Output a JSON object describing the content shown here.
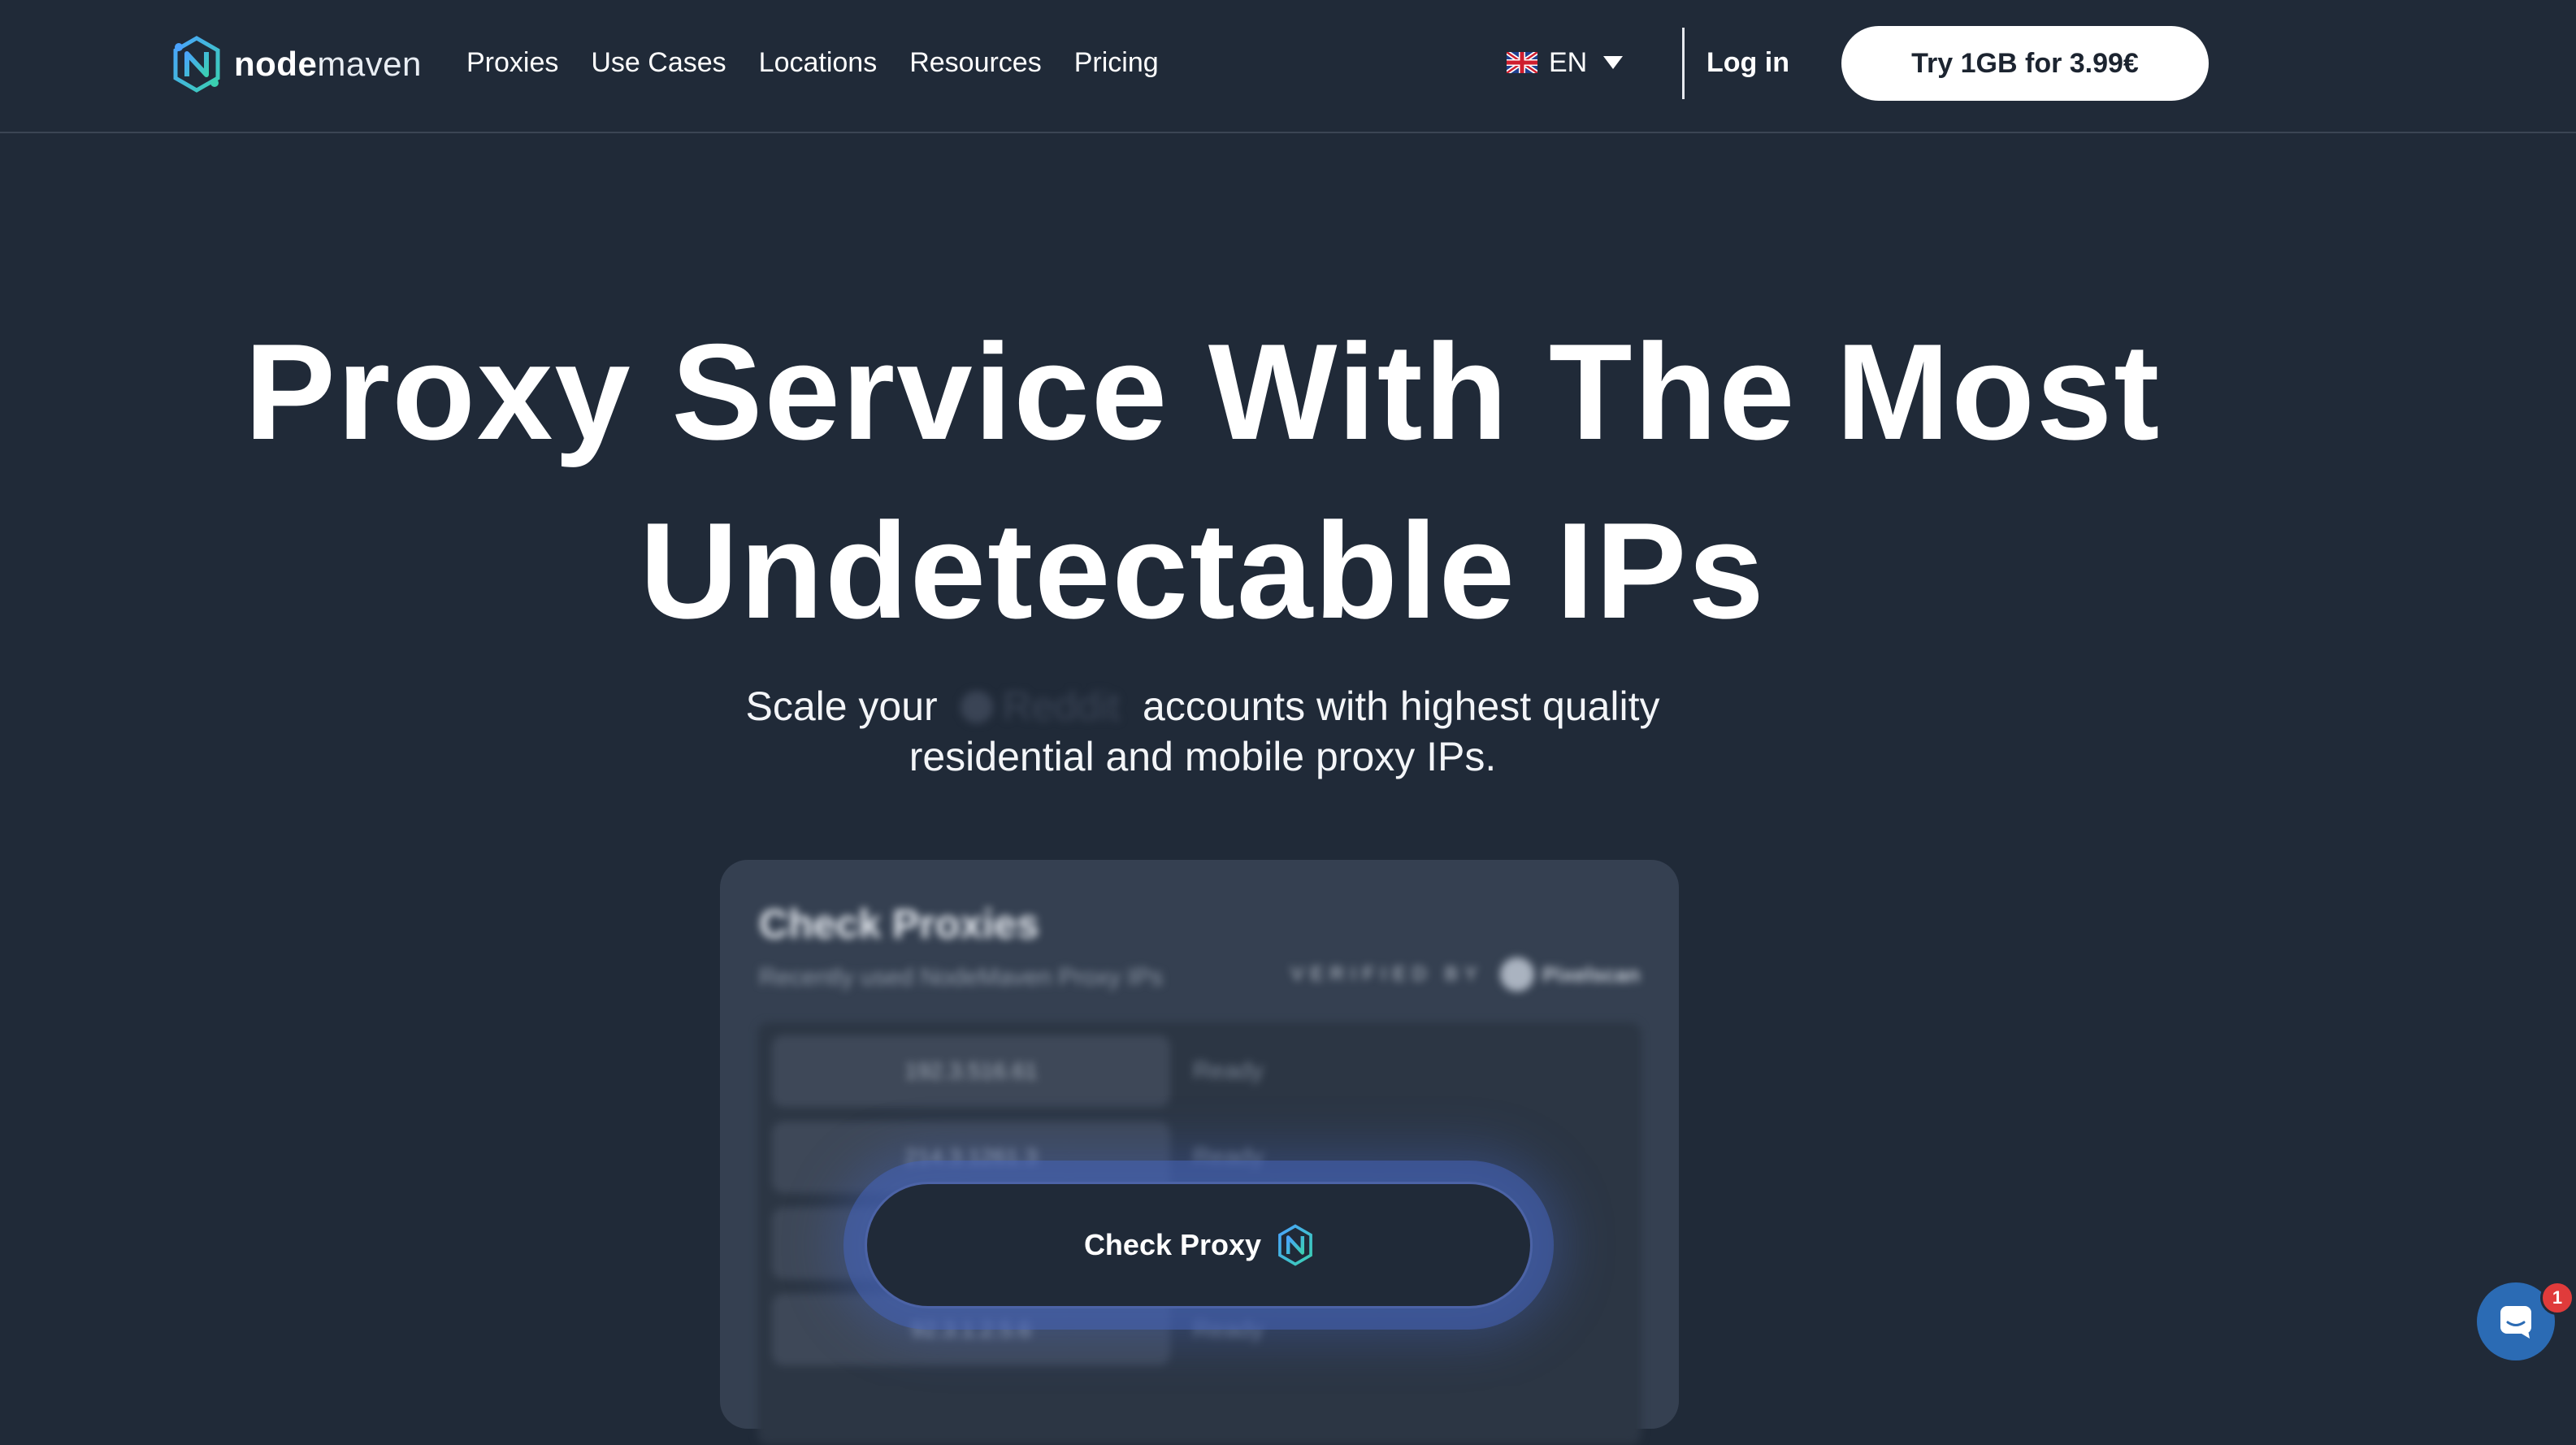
{
  "header": {
    "logo_bold": "node",
    "logo_light": "maven",
    "nav": [
      "Proxies",
      "Use Cases",
      "Locations",
      "Resources",
      "Pricing"
    ],
    "language": "EN",
    "login": "Log in",
    "cta": "Try 1GB for 3.99€"
  },
  "hero": {
    "title_line1": "Proxy Service With The Most",
    "title_line2": "Undetectable IPs",
    "subtitle_before": "Scale your",
    "rotating_word": "Reddit",
    "subtitle_after": "accounts with highest quality",
    "subtitle_line2": "residential and mobile proxy IPs."
  },
  "card": {
    "title": "Check Proxies",
    "subtitle": "Recently used NodeMaven Proxy IPs",
    "verified_label": "VERIFIED BY",
    "verified_brand": "Pixelscan",
    "rows": [
      {
        "ip": "192.3.516.61",
        "status": "Ready"
      },
      {
        "ip": "214.3.1261.3",
        "status": "Ready"
      },
      {
        "ip": "",
        "status": ""
      },
      {
        "ip": "92.3.1.2.5.6",
        "status": "Ready"
      }
    ]
  },
  "check_button": "Check Proxy",
  "chat": {
    "badge_count": "1"
  },
  "colors": {
    "background": "#202a38",
    "card": "#354051",
    "accent_glow": "#4664b9",
    "badge": "#e03b3b",
    "chat": "#2b6bb4"
  }
}
